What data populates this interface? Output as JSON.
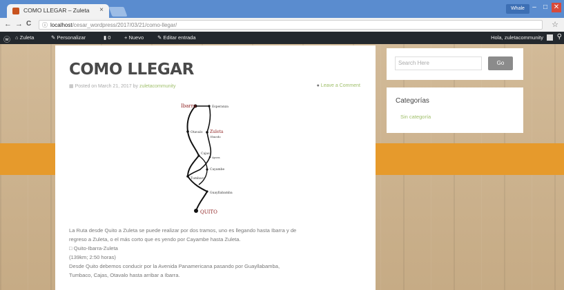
{
  "browser": {
    "tab_title": "COMO LLEGAR – Zuleta",
    "tab_close": "×",
    "user_badge": "Whale",
    "url_host": "localhost",
    "url_path": "/cesar_wordpress/2017/03/21/como-llegar/",
    "back": "←",
    "forward": "→",
    "reload": "C",
    "info": "ⓘ",
    "star": "☆",
    "win_min": "–",
    "win_max": "□",
    "win_close": "✕"
  },
  "adminbar": {
    "wp_icon": "ⓦ",
    "site": "Zuleta",
    "customize": "Personalizar",
    "comments": "0",
    "new": "Nuevo",
    "edit": "Editar entrada",
    "greeting": "Hola, zuletacommunity",
    "search_icon": "⚲"
  },
  "post": {
    "title": "COMO LLEGAR",
    "meta_prefix": "Posted on March 21, 2017 by",
    "author": "zuletacommunity",
    "comment_link": "Leave a Comment",
    "map_labels": [
      "Ibarra",
      "Esperanza",
      "Otavalo",
      "Zuleta",
      "Olmedo",
      "Cajas",
      "Ayora",
      "Cayambe",
      "Tumbaco",
      "Guayllabamba",
      "QUITO"
    ],
    "paragraphs": [
      "La Ruta desde Quito a Zuleta se puede realizar por dos tramos, uno es llegando hasta Ibarra y de",
      "regreso a Zuleta, o el más corto que es yendo por Cayambe hasta Zuleta.",
      "□ Quito-Ibarra-Zuleta",
      "(139km; 2:50 horas)",
      "Desde Quito debemos conducir por la Avenida Panamericana pasando por Guayllabamba,",
      "Tumbaco, Cajas, Otavalo hasta arribar a Ibarra."
    ]
  },
  "sidebar": {
    "search_placeholder": "Search Here",
    "search_button": "Go",
    "categories_title": "Categorías",
    "categories": [
      "Sin categoría"
    ]
  },
  "colors": {
    "accent_orange": "#e69a2c",
    "link_green": "#9fbf6a",
    "admin_bar": "#23282d",
    "tab_strip": "#5a8ccf"
  }
}
